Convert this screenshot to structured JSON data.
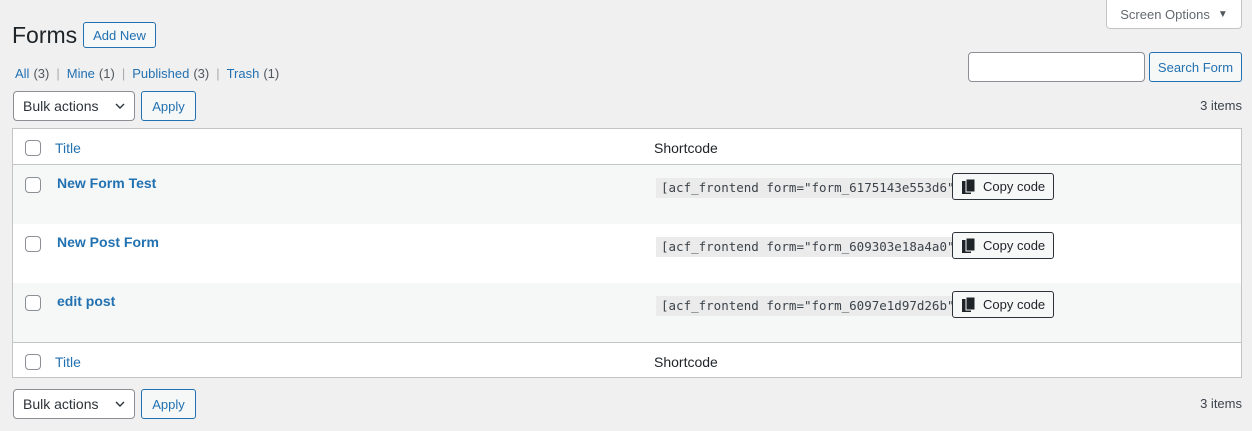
{
  "screen_options": {
    "label": "Screen Options",
    "caret": "▼"
  },
  "page": {
    "title": "Forms",
    "add_new_label": "Add New"
  },
  "filters": [
    {
      "label": "All",
      "count": "(3)"
    },
    {
      "label": "Mine",
      "count": "(1)"
    },
    {
      "label": "Published",
      "count": "(3)"
    },
    {
      "label": "Trash",
      "count": "(1)"
    }
  ],
  "filter_separator": "|",
  "search": {
    "value": "",
    "placeholder": "",
    "button_label": "Search Form"
  },
  "bulk_actions": {
    "selected": "Bulk actions",
    "apply_label": "Apply"
  },
  "items_count": "3 items",
  "table": {
    "columns": {
      "title": "Title",
      "shortcode": "Shortcode"
    },
    "rows": [
      {
        "title": "New Form Test",
        "shortcode": "[acf_frontend form=\"form_6175143e553d6\"]",
        "copy_label": "Copy code"
      },
      {
        "title": "New Post Form",
        "shortcode": "[acf_frontend form=\"form_609303e18a4a0\"]",
        "copy_label": "Copy code"
      },
      {
        "title": "edit post",
        "shortcode": "[acf_frontend form=\"form_6097e1d97d26b\"]",
        "copy_label": "Copy code"
      }
    ]
  },
  "colors": {
    "link": "#2271b1",
    "background": "#f0f0f1",
    "border": "#c3c4c7",
    "alt_row": "#f6f7f7"
  },
  "icons": {
    "copy": "copy-icon",
    "dropdown": "chevron-down-icon",
    "screen_options": "caret-down-icon"
  }
}
